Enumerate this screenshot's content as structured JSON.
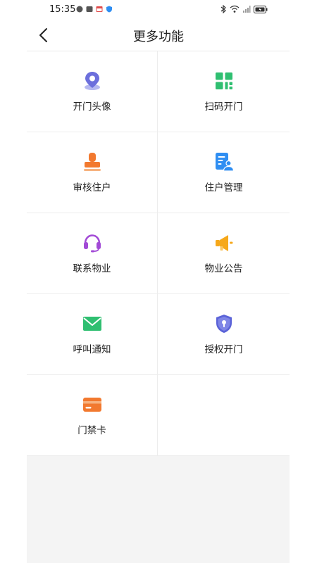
{
  "status_bar": {
    "time": "15:35"
  },
  "header": {
    "title": "更多功能"
  },
  "menu": [
    {
      "label": "开门头像",
      "icon": "location-pin-icon"
    },
    {
      "label": "扫码开门",
      "icon": "qr-code-icon"
    },
    {
      "label": "审核住户",
      "icon": "stamp-icon"
    },
    {
      "label": "住户管理",
      "icon": "resident-card-icon"
    },
    {
      "label": "联系物业",
      "icon": "headset-icon"
    },
    {
      "label": "物业公告",
      "icon": "megaphone-icon"
    },
    {
      "label": "呼叫通知",
      "icon": "envelope-icon"
    },
    {
      "label": "授权开门",
      "icon": "shield-lock-icon"
    },
    {
      "label": "门禁卡",
      "icon": "card-icon"
    }
  ],
  "colors": {
    "purple": "#6c6fdc",
    "green": "#2fbf71",
    "orange": "#f2792f",
    "blue": "#2f8ef2",
    "violet": "#a24ad6",
    "amber": "#f6a81a",
    "indigo": "#5b63d8"
  }
}
